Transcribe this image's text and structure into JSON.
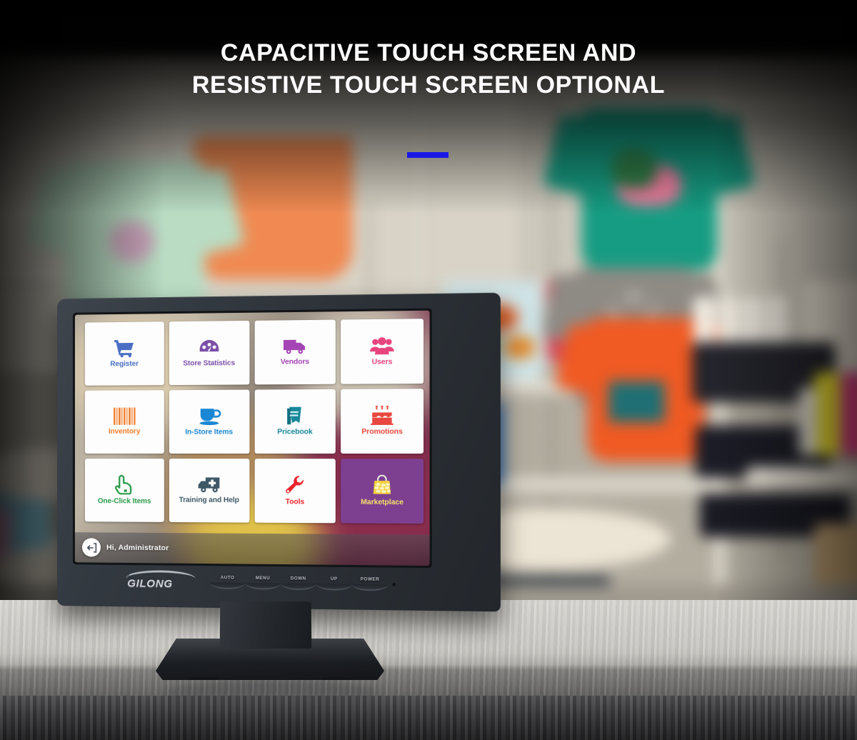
{
  "headline": {
    "line1": "Capacitive Touch Screen and",
    "line2": "Resistive Touch Screen Optional",
    "accent_color": "#1919e6"
  },
  "monitor": {
    "brand": "GILONG",
    "osd_buttons": [
      {
        "label": "AUTO"
      },
      {
        "label": "MENU"
      },
      {
        "label": "DOWN"
      },
      {
        "label": "UP"
      },
      {
        "label": "POWER"
      }
    ]
  },
  "pos_screen": {
    "tiles": [
      {
        "label": "Register",
        "icon": "shopping-cart-icon",
        "color": "#4a6fc4",
        "highlight": false
      },
      {
        "label": "Store Statistics",
        "icon": "gauge-icon",
        "color": "#7b4fa8",
        "highlight": false
      },
      {
        "label": "Vendors",
        "icon": "delivery-truck-icon",
        "color": "#a545b5",
        "highlight": false
      },
      {
        "label": "Users",
        "icon": "users-group-icon",
        "color": "#e8447f",
        "highlight": false
      },
      {
        "label": "Inventory",
        "icon": "barcode-icon",
        "color": "#f07d2a",
        "highlight": false
      },
      {
        "label": "In-Store Items",
        "icon": "coffee-cup-icon",
        "color": "#1b87d4",
        "highlight": false
      },
      {
        "label": "Pricebook",
        "icon": "book-icon",
        "color": "#17879a",
        "highlight": false
      },
      {
        "label": "Promotions",
        "icon": "birthday-cake-icon",
        "color": "#e8483f",
        "highlight": false
      },
      {
        "label": "One-Click Items",
        "icon": "pointing-hand-icon",
        "color": "#2a9a4a",
        "highlight": false
      },
      {
        "label": "Training and Help",
        "icon": "ambulance-icon",
        "color": "#3e5866",
        "highlight": false
      },
      {
        "label": "Tools",
        "icon": "wrench-icon",
        "color": "#e8252b",
        "highlight": false
      },
      {
        "label": "Marketplace",
        "icon": "shopping-bag-icon",
        "color": "#f2d23c",
        "highlight": true,
        "tile_bg": "#7d4091",
        "label_color": "#f4e06a"
      }
    ],
    "taskbar": {
      "greeting": "Hi, Administrator",
      "logout_icon": "logout-arrow-icon"
    }
  }
}
